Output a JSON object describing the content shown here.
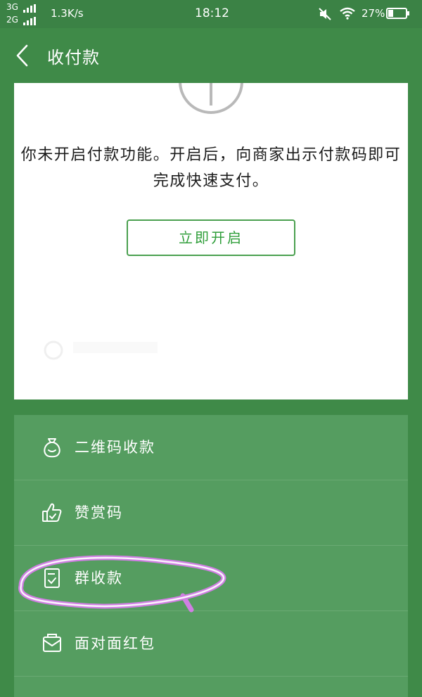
{
  "status_bar": {
    "network_top": "3G",
    "network_bottom": "2G",
    "speed": "1.3K/s",
    "time": "18:12",
    "battery": "27%",
    "icons": [
      "signal-icon",
      "mute-icon",
      "wifi-icon",
      "battery-icon"
    ]
  },
  "header": {
    "back_icon": "chevron-left-icon",
    "title": "收付款"
  },
  "card": {
    "message": "你未开启付款功能。开启后，向商家出示付款码即可完成快速支付。",
    "button_label": "立即开启"
  },
  "menu": {
    "items": [
      {
        "label": "二维码收款",
        "icon": "money-bag-icon"
      },
      {
        "label": "赞赏码",
        "icon": "thumbs-up-icon"
      },
      {
        "label": "群收款",
        "icon": "group-receipt-icon"
      },
      {
        "label": "面对面红包",
        "icon": "red-envelope-icon"
      }
    ]
  },
  "colors": {
    "background": "#3f8a48",
    "menu_background": "#559d60",
    "accent_green": "#2f9e3a",
    "highlight": "#d77dea"
  }
}
